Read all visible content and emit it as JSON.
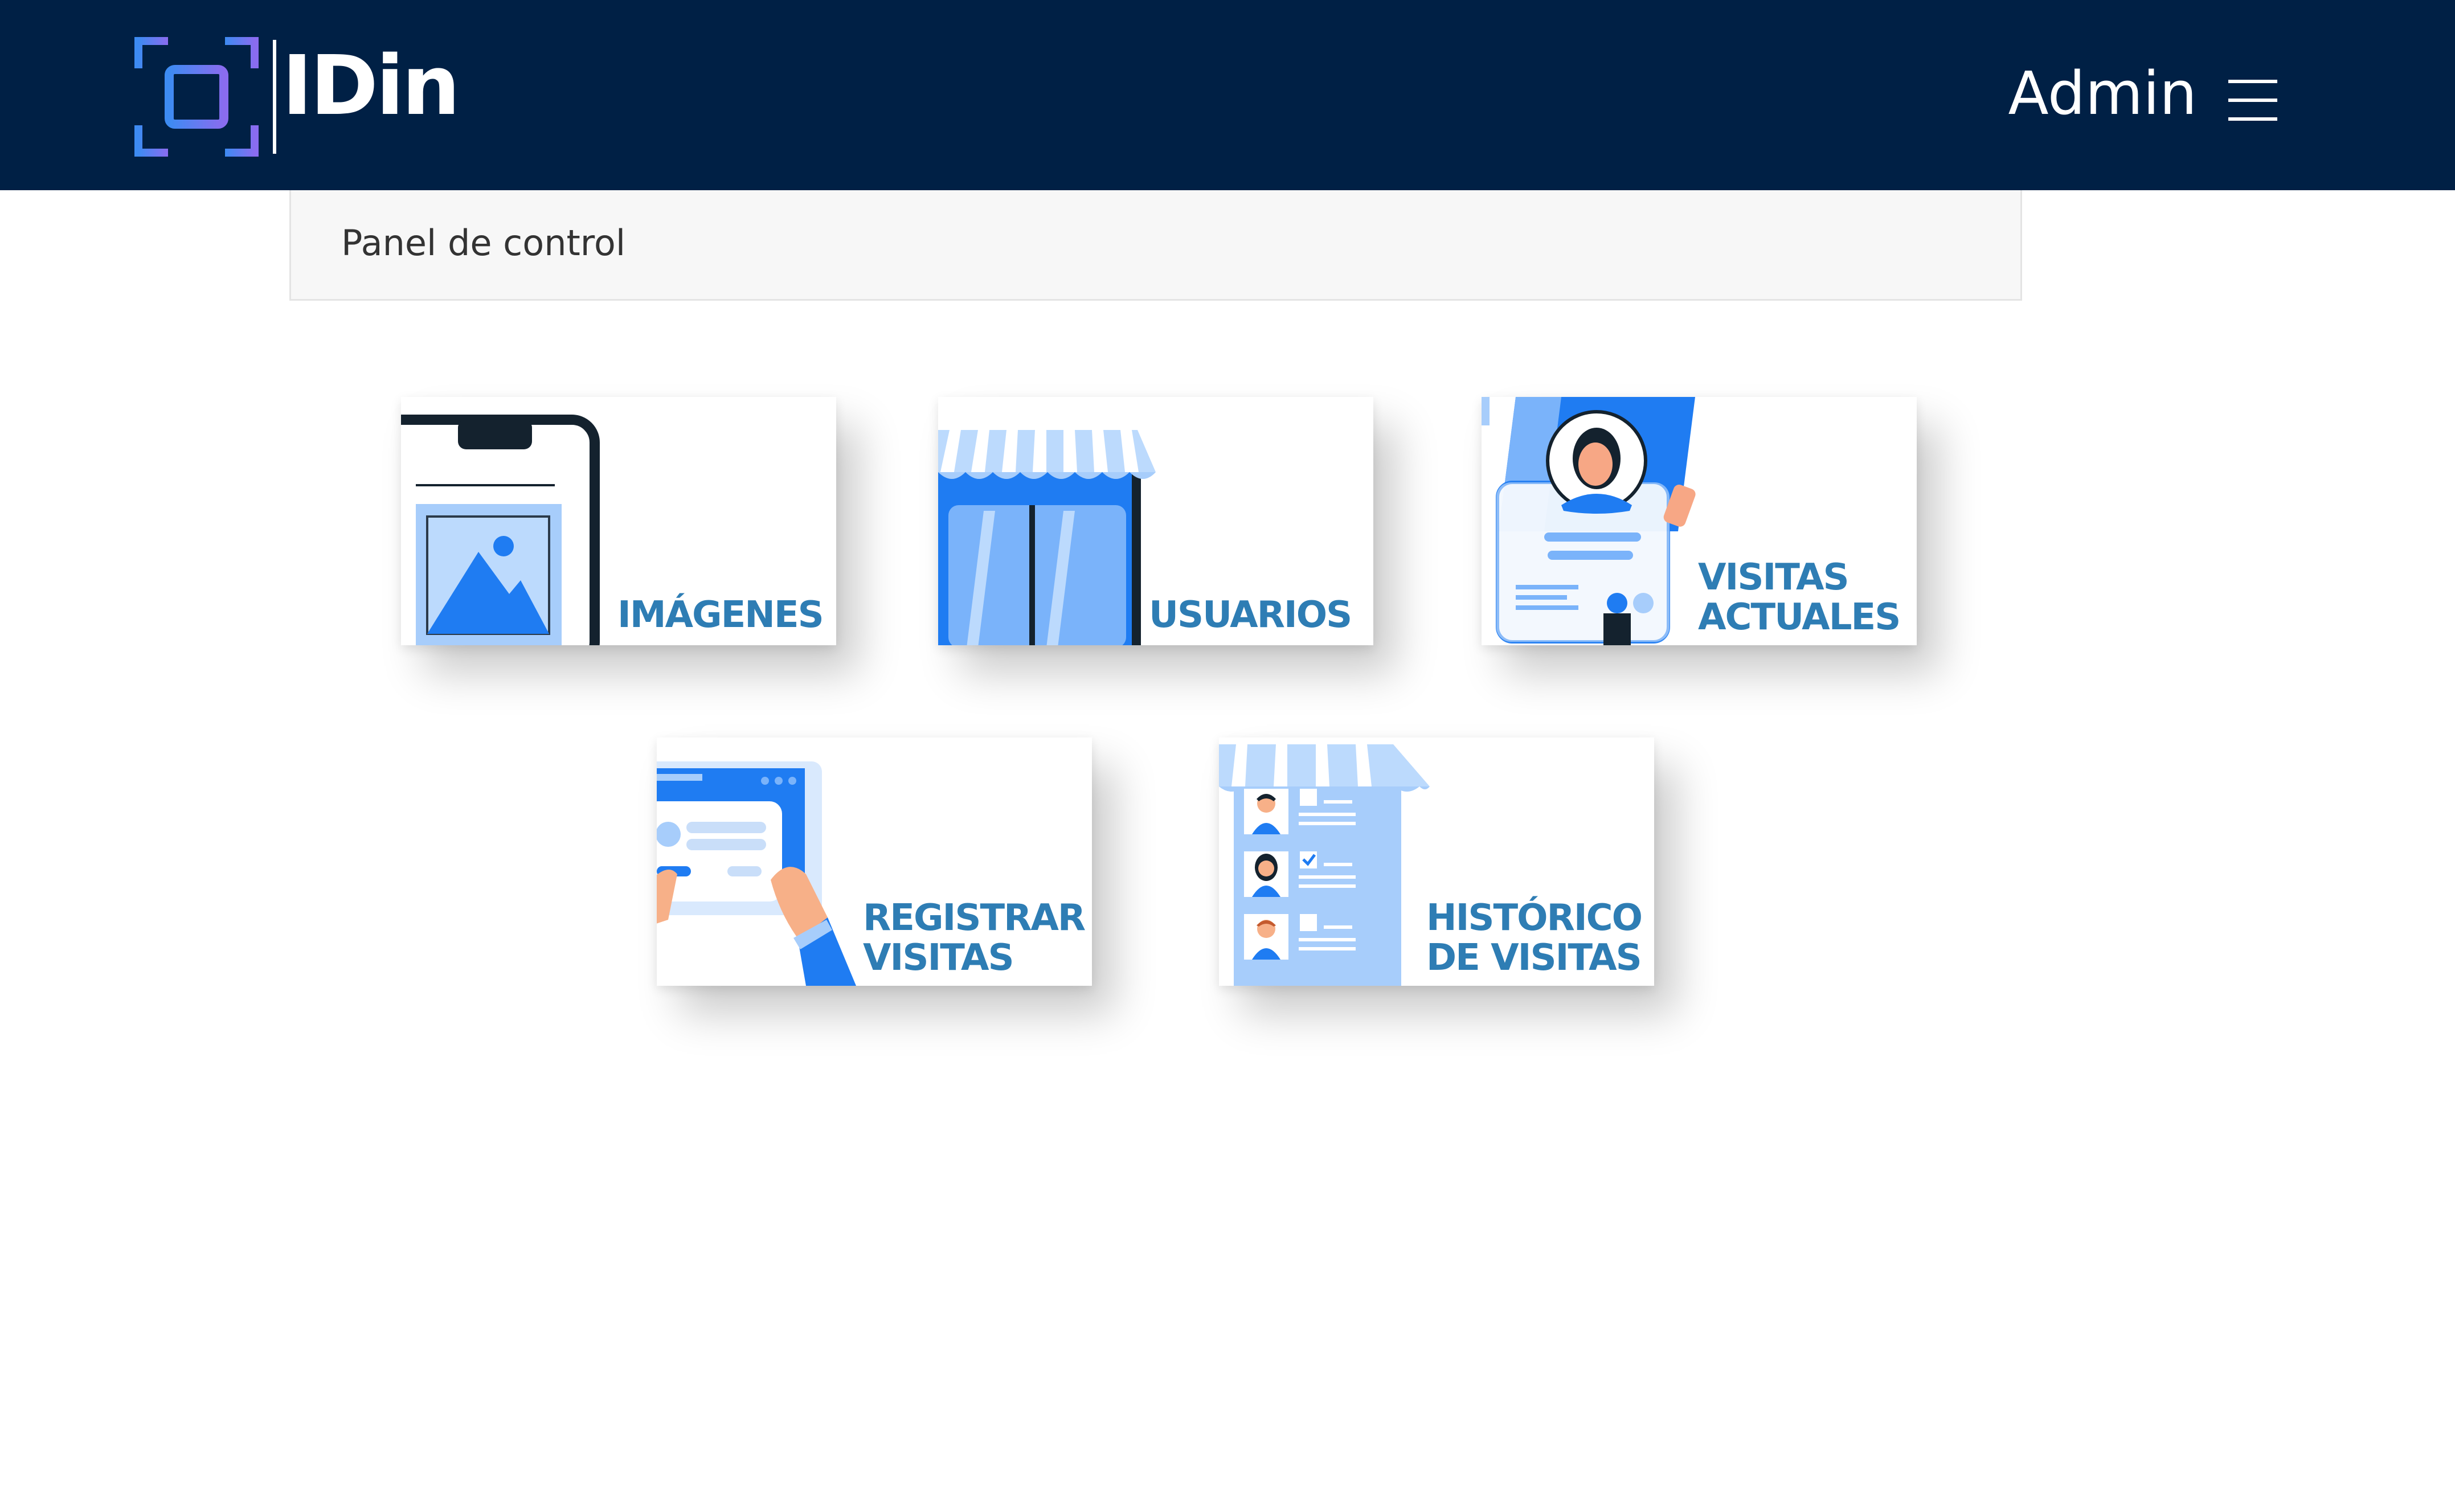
{
  "header": {
    "brand": "IDin",
    "user": "Admin",
    "menu_icon": "hamburger-icon"
  },
  "breadcrumb": {
    "current": "Panel de control"
  },
  "tiles": [
    {
      "label": "IMÁGENES",
      "icon": "image-phone-illustration"
    },
    {
      "label": "USUARIOS",
      "icon": "storefront-illustration"
    },
    {
      "label": "VISITAS\nACTUALES",
      "icon": "id-badge-illustration"
    },
    {
      "label": "REGISTRAR\nVISITAS",
      "icon": "tablet-form-illustration"
    },
    {
      "label": "HISTÓRICO\nDE VISITAS",
      "icon": "checklist-illustration"
    }
  ],
  "colors": {
    "navbar": "#002045",
    "tile_label": "#2e7db4",
    "accent_blue": "#1f7cf2",
    "light_blue": "#a7cdfb",
    "logo_blue": "#3d8bf2",
    "logo_purple": "#8a6cf0"
  }
}
